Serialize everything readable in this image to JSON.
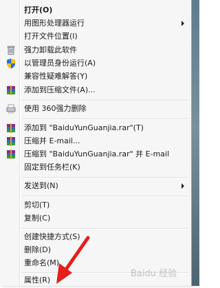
{
  "menu": {
    "items": [
      {
        "label": "打开(O)",
        "bold": true
      },
      {
        "label": "用图形处理器运行",
        "submenu": true
      },
      {
        "label": "打开文件位置(I)"
      },
      {
        "label": "强力卸载此软件",
        "icon": "trash-icon"
      },
      {
        "label": "以管理员身份运行(A)",
        "icon": "uac-shield-icon"
      },
      {
        "label": "兼容性疑难解答(Y)"
      },
      {
        "label": "添加到压缩文件(A)...",
        "icon": "winrar-icon"
      },
      {
        "label": "使用 360强力删除",
        "icon": "shredder-icon"
      },
      {
        "label": "添加到 \"BaiduYunGuanjia.rar\"(T)",
        "icon": "winrar-icon"
      },
      {
        "label": "压缩并 E-mail...",
        "icon": "winrar-icon"
      },
      {
        "label": "压缩到 \"BaiduYunGuanjia.rar\" 并 E-mail",
        "icon": "winrar-icon"
      },
      {
        "label": "固定到任务栏(K)"
      },
      {
        "label": "发送到(N)",
        "submenu": true
      },
      {
        "label": "剪切(T)"
      },
      {
        "label": "复制(C)"
      },
      {
        "label": "创建快捷方式(S)"
      },
      {
        "label": "删除(D)"
      },
      {
        "label": "重命名(M)"
      },
      {
        "label": "属性(R)"
      }
    ]
  },
  "annotation": {
    "color": "#e3201c"
  },
  "watermark": {
    "text": "Baidu 经验"
  }
}
